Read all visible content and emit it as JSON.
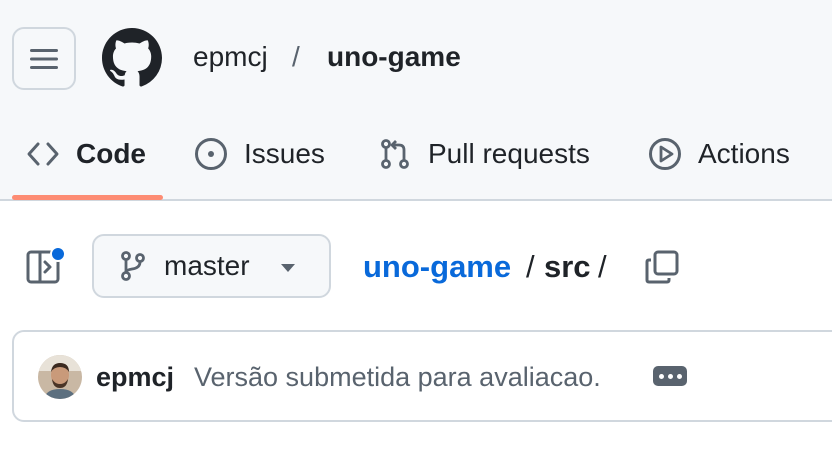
{
  "header": {
    "owner": "epmcj",
    "separator": "/",
    "repo": "uno-game"
  },
  "tabs": [
    {
      "label": "Code",
      "icon": "code-icon",
      "selected": true
    },
    {
      "label": "Issues",
      "icon": "issue-opened-icon",
      "selected": false
    },
    {
      "label": "Pull requests",
      "icon": "git-pull-request-icon",
      "selected": false
    },
    {
      "label": "Actions",
      "icon": "play-icon",
      "selected": false
    }
  ],
  "toolbar": {
    "branch": "master",
    "breadcrumb": {
      "repo": "uno-game",
      "sep1": "/",
      "folder": "src",
      "sep2": "/"
    }
  },
  "commit": {
    "author": "epmcj",
    "message": "Versão submetida para avaliacao."
  },
  "colors": {
    "accent_underline": "#fd8c73",
    "link": "#0969da",
    "notification_dot": "#0969da",
    "header_bg": "#f6f8fa"
  }
}
